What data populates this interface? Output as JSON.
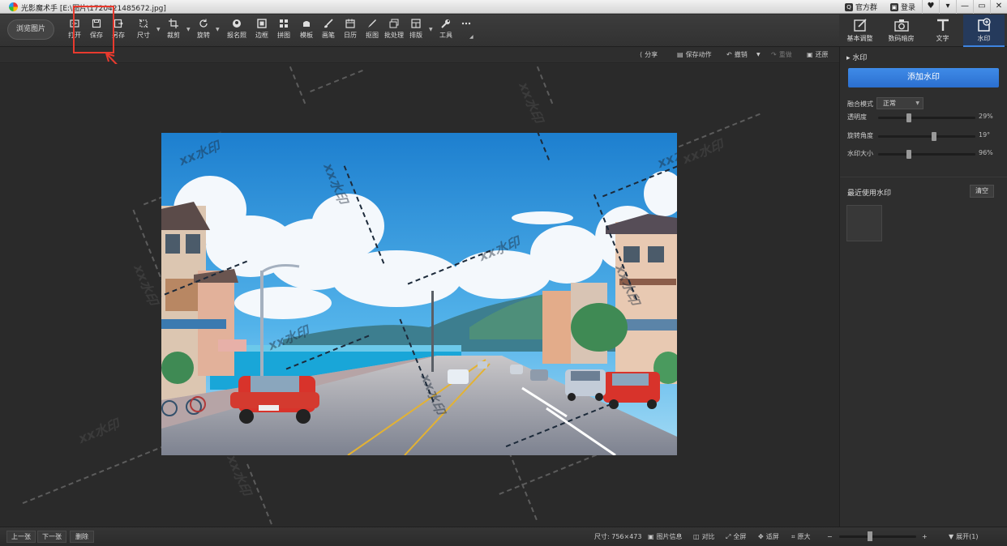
{
  "window": {
    "title": "光影魔术手 [E:\\图片\\1720421485672.jpg]",
    "links": [
      {
        "label": "官方群",
        "icon": "qq-icon"
      },
      {
        "label": "登录",
        "icon": "login-icon"
      }
    ],
    "controls": [
      "♥",
      "▾",
      "—",
      "▭",
      "✕"
    ]
  },
  "toolbar": {
    "browse_label": "浏览图片",
    "tools": [
      {
        "label": "打开",
        "icon": "open-icon"
      },
      {
        "label": "保存",
        "icon": "save-icon"
      },
      {
        "label": "另存",
        "icon": "save-as-icon"
      },
      {
        "label": "尺寸",
        "icon": "resize-icon"
      },
      {
        "label": "裁剪",
        "icon": "crop-icon"
      },
      {
        "label": "旋转",
        "icon": "rotate-icon"
      },
      {
        "label": "报名照",
        "icon": "id-photo-icon"
      },
      {
        "label": "边框",
        "icon": "border-icon"
      },
      {
        "label": "拼图",
        "icon": "collage-icon"
      },
      {
        "label": "模板",
        "icon": "template-icon"
      },
      {
        "label": "画笔",
        "icon": "brush-icon"
      },
      {
        "label": "日历",
        "icon": "calendar-icon"
      },
      {
        "label": "抠图",
        "icon": "cutout-icon"
      },
      {
        "label": "批处理",
        "icon": "batch-icon"
      },
      {
        "label": "排版",
        "icon": "layout-icon"
      },
      {
        "label": "工具",
        "icon": "wrench-icon"
      },
      {
        "label": "",
        "icon": "more-icon"
      }
    ]
  },
  "panel_tabs": [
    {
      "label": "基本调整",
      "icon": "edit-icon",
      "active": false
    },
    {
      "label": "数码暗房",
      "icon": "camera-icon",
      "active": false
    },
    {
      "label": "文字",
      "icon": "text-icon",
      "active": false
    },
    {
      "label": "水印",
      "icon": "watermark-icon",
      "active": true
    }
  ],
  "subbar": {
    "share": "分享",
    "save_action": "保存动作",
    "undo": "撤销",
    "redo": "重做",
    "restore": "还原"
  },
  "watermark_text": "xx水印",
  "panel": {
    "header": "水印",
    "add_button": "添加水印",
    "blend_label": "融合模式",
    "blend_value": "正常",
    "opacity_label": "透明度",
    "opacity_value": "29%",
    "opacity": 0.29,
    "rotation_label": "旋转角度",
    "rotation_value": "19°",
    "rotation": 19,
    "size_label": "水印大小",
    "size_value": "96%",
    "size": 0.96,
    "recent_label": "最近使用水印",
    "clear_button": "清空"
  },
  "status": {
    "prev": "上一张",
    "next": "下一张",
    "delete": "删除",
    "dimensions": "尺寸: 756×473",
    "info": "图片信息",
    "compare": "对比",
    "fullscreen": "全屏",
    "fit": "适屏",
    "original": "原大",
    "zoom_minus": "−",
    "zoom_plus": "+",
    "expand": "展开(1)"
  },
  "colors": {
    "accent": "#2b6fd0",
    "highlight": "#e83a2e",
    "sky": "#2e8fd6",
    "sea": "#1aa6d8",
    "car": "#d8332b"
  }
}
